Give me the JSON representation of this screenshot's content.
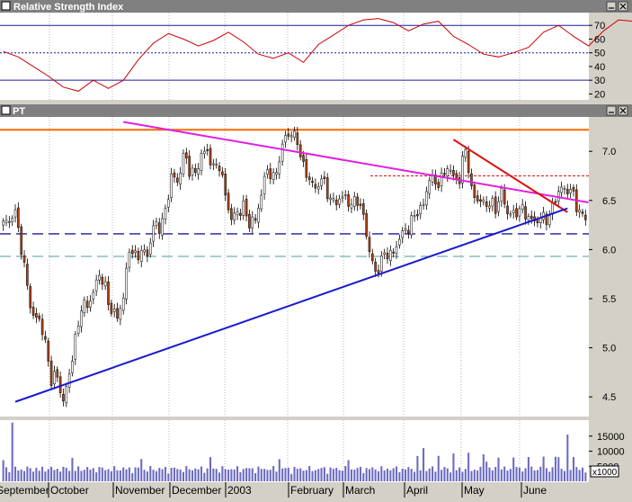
{
  "panels": {
    "rsi": {
      "title": "Relative Strength Index"
    },
    "price": {
      "title": "PT"
    }
  },
  "colors": {
    "rsi_line": "#cc0000",
    "candle_up": "#ffffff",
    "candle_down": "#b5410f",
    "candle_outline": "#000000",
    "volume_bar": "#6b6bc2",
    "resistance_line": "#ff6a00",
    "down_trend_magenta": "#e020e0",
    "down_trend_red": "#dd1111",
    "up_trend_blue": "#1a1ad0",
    "support_dashed_navy": "#1a1aa0",
    "support_dashed_teal": "#6fb0b0",
    "resistance_dotted_red": "#dd1111"
  },
  "chart_data": [
    {
      "type": "line",
      "title": "Relative Strength Index",
      "ylim": [
        17,
        78
      ],
      "yticks": [
        20,
        30,
        40,
        50,
        60,
        70
      ],
      "reference_lines": {
        "solid": [
          30,
          70
        ],
        "dotted": [
          50
        ]
      },
      "x_start": 0,
      "x_step": 5,
      "series": [
        {
          "values": [
            51,
            47,
            40,
            33,
            25,
            22,
            30,
            24,
            30,
            45,
            57,
            64,
            60,
            55,
            59,
            65,
            58,
            49,
            46,
            50,
            43,
            56,
            63,
            70,
            74,
            75,
            72,
            66,
            71,
            73,
            62,
            56,
            49,
            47,
            50,
            54,
            65,
            70,
            62,
            55,
            66,
            74,
            73,
            69,
            58,
            51,
            45,
            44,
            49,
            48,
            44,
            34,
            22,
            30,
            42,
            51,
            52,
            47,
            56,
            60,
            70,
            66,
            52,
            60,
            71,
            68,
            58,
            48,
            56,
            50,
            58,
            54,
            49,
            45,
            42,
            48,
            55,
            47,
            50,
            46,
            58,
            60,
            57,
            55,
            50,
            45,
            42,
            46,
            52,
            48,
            44,
            42
          ]
        }
      ]
    },
    {
      "type": "candlestick",
      "title": "PT",
      "ylim": [
        4.3,
        7.35
      ],
      "yticks": [
        4.5,
        5.0,
        5.5,
        6.0,
        6.5,
        7.0
      ],
      "x_categories": [
        "September",
        "October",
        "November",
        "December",
        "2003",
        "February",
        "March",
        "April",
        "May",
        "June"
      ],
      "trading_days": 195,
      "close": [
        6.26,
        6.3,
        6.38,
        6.02,
        5.62,
        5.3,
        5.3,
        5.04,
        4.68,
        4.71,
        4.44,
        4.74,
        5.07,
        5.42,
        5.43,
        5.56,
        5.76,
        5.6,
        5.37,
        5.32,
        5.51,
        6.02,
        5.92,
        5.99,
        5.94,
        6.24,
        6.23,
        6.37,
        6.76,
        6.68,
        6.96,
        6.82,
        6.76,
        6.97,
        7.0,
        6.83,
        6.87,
        6.55,
        6.31,
        6.38,
        6.43,
        6.27,
        6.3,
        6.57,
        6.83,
        6.71,
        6.92,
        7.16,
        7.18,
        7.11,
        6.83,
        6.72,
        6.61,
        6.73,
        6.58,
        6.47,
        6.52,
        6.53,
        6.45,
        6.52,
        6.33,
        5.99,
        5.75,
        5.9,
        5.97,
        5.95,
        6.13,
        6.19,
        6.29,
        6.39,
        6.45,
        6.74,
        6.67,
        6.71,
        6.85,
        6.74,
        6.71,
        7.05,
        6.59,
        6.51,
        6.47,
        6.47,
        6.42,
        6.58,
        6.38,
        6.35,
        6.42,
        6.37,
        6.29,
        6.3,
        6.33,
        6.32,
        6.54,
        6.62,
        6.61,
        6.56,
        6.36,
        6.34
      ],
      "reference_lines": {
        "horizontal_solid": [
          7.22
        ],
        "horizontal_dotted": [
          6.75
        ],
        "horizontal_dashed": [
          6.16,
          5.93
        ]
      },
      "trendlines": [
        {
          "points": [
            [
              40,
              7.3
            ],
            [
              195,
              6.48
            ]
          ]
        },
        {
          "points": [
            [
              150,
              7.12
            ],
            [
              188,
              6.38
            ]
          ]
        },
        {
          "points": [
            [
              4,
              4.45
            ],
            [
              188,
              6.42
            ]
          ]
        }
      ]
    },
    {
      "type": "bar",
      "title": "",
      "ylim": [
        0,
        20000
      ],
      "yticks": [
        5000,
        10000,
        15000
      ],
      "unit_label": "x1000"
    }
  ]
}
